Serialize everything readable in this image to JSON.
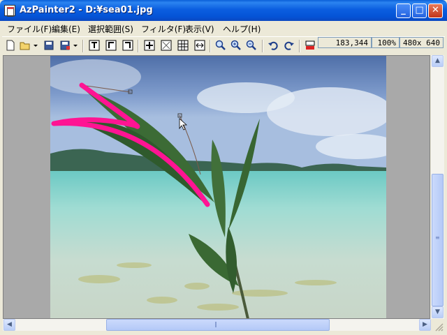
{
  "window": {
    "title": "AzPainter2 - D:¥sea01.jpg",
    "min_label": "_",
    "max_label": "□",
    "close_label": "✕"
  },
  "menu": [
    {
      "label": "ファイル(F)"
    },
    {
      "label": "編集(E)"
    },
    {
      "label": "選択範囲(S)"
    },
    {
      "label": "フィルタ(F)"
    },
    {
      "label": "表示(V)"
    },
    {
      "label": "ヘルプ(H)"
    }
  ],
  "toolbar": {
    "tools": [
      "new-icon",
      "open-icon",
      "dropdown-icon",
      "save-icon",
      "save-as-icon",
      "dropdown-icon",
      "text-top-icon",
      "text-mid-icon",
      "text-bottom-icon",
      "fit-icon",
      "transparent-icon",
      "grid-icon",
      "fit-width-icon",
      "zoom-icon",
      "zoom-in-icon",
      "zoom-out-icon",
      "undo-icon",
      "redo-icon",
      "color-icon"
    ]
  },
  "status": {
    "cursor": "183,344",
    "zoom": "100%",
    "size": "480x 640"
  },
  "colors": {
    "titlebar": "#0453d6",
    "stroke": "#ff1493",
    "canvas_bg": "#a9a9a9"
  }
}
